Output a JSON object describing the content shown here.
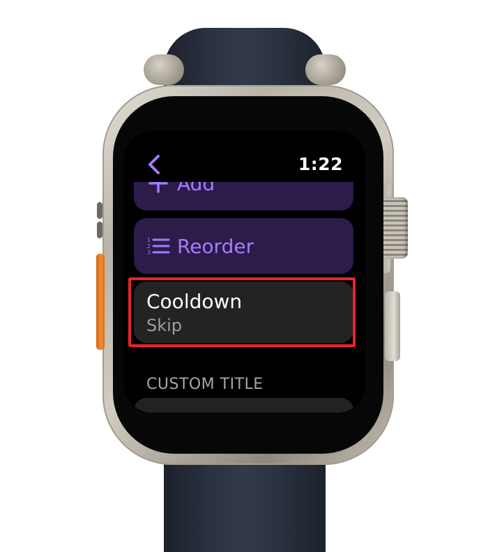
{
  "screen": {
    "time": "1:22",
    "back_icon": "chevron-left-icon",
    "rows": {
      "add": {
        "label": "Add",
        "icon": "plus-icon"
      },
      "reorder": {
        "label": "Reorder",
        "icon": "numbered-list-icon"
      },
      "cooldown": {
        "title": "Cooldown",
        "subtitle": "Skip"
      }
    },
    "section_header": "CUSTOM TITLE"
  },
  "colors": {
    "accent": "#a57aff",
    "row_purple": "#2b1c4a",
    "row_dark": "#232323",
    "highlight": "#e8242c"
  }
}
